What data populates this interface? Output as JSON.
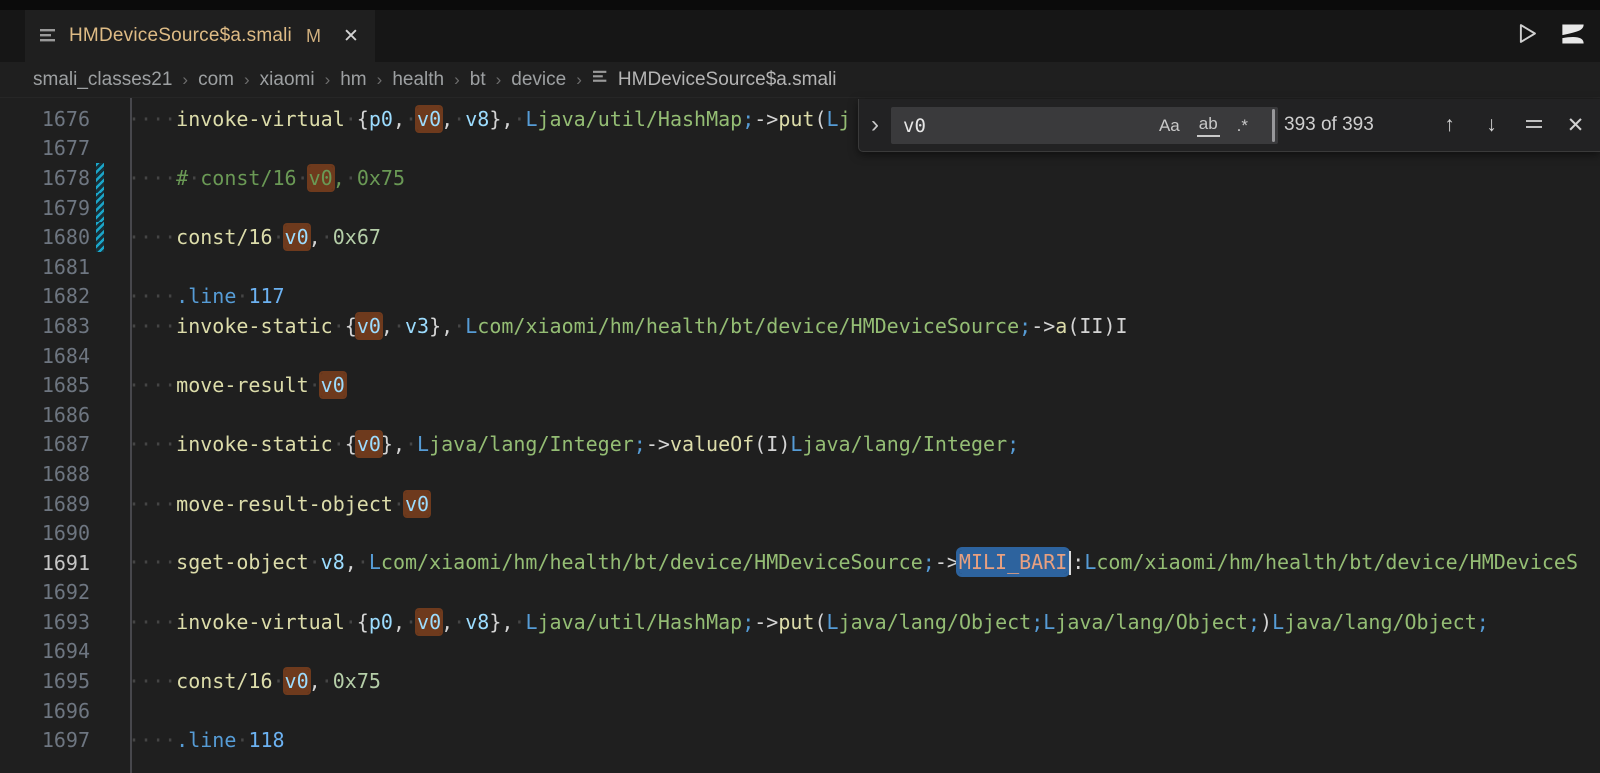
{
  "tab": {
    "title": "HMDeviceSource$a.smali",
    "modified_badge": "M",
    "close_glyph": "✕"
  },
  "breadcrumbs": {
    "items": [
      "smali_classes21",
      "com",
      "xiaomi",
      "hm",
      "health",
      "bt",
      "device"
    ],
    "separator": "›",
    "file_label": "HMDeviceSource$a.smali"
  },
  "find": {
    "expand_glyph": "›",
    "query": "v0",
    "match_case_label": "Aa",
    "whole_word_label": "ab",
    "regex_label": ".*",
    "results": "393 of 393",
    "prev_glyph": "↑",
    "next_glyph": "↓",
    "close_glyph": "✕"
  },
  "colors": {
    "op": "#dcdcaa",
    "reg": "#9cdcfe",
    "punc": "#d4d4d4",
    "type": "#569cd6",
    "path": "#94bd74",
    "num": "#b5cea8",
    "bnum": "#6cb2f2",
    "comment": "#6a9955",
    "field": "#e8a080",
    "ws": "#454545",
    "match": "#6e3a1d",
    "sel": "#2d639e",
    "tabModified": "#debb85",
    "gutterModified": "#1ba6ca",
    "lineNumber": "#6e7681",
    "lineNumberActive": "#c6c6c6"
  },
  "editor": {
    "lines": [
      {
        "n": "1676",
        "mod": false,
        "active": false,
        "seg": [
          [
            "ws",
            "····"
          ],
          [
            "op",
            "invoke-virtual"
          ],
          [
            "ws",
            "·"
          ],
          [
            "punc",
            "{"
          ],
          [
            "reg",
            "p0"
          ],
          [
            "punc",
            ","
          ],
          [
            "ws",
            "·"
          ],
          [
            "reg",
            "v0",
            "m"
          ],
          [
            "punc",
            ","
          ],
          [
            "ws",
            "·"
          ],
          [
            "reg",
            "v8"
          ],
          [
            "punc",
            "},"
          ],
          [
            "ws",
            "·"
          ],
          [
            "type",
            "L"
          ],
          [
            "path",
            "java/util/HashMap"
          ],
          [
            "type",
            ";"
          ],
          [
            "punc",
            "->"
          ],
          [
            "op",
            "put"
          ],
          [
            "punc",
            "("
          ],
          [
            "type",
            "L"
          ],
          [
            "path",
            "j"
          ]
        ]
      },
      {
        "n": "1677",
        "mod": false,
        "active": false,
        "seg": []
      },
      {
        "n": "1678",
        "mod": true,
        "active": false,
        "seg": [
          [
            "ws",
            "····"
          ],
          [
            "comment",
            "#"
          ],
          [
            "ws",
            "·"
          ],
          [
            "comment",
            "const/16"
          ],
          [
            "ws",
            "·"
          ],
          [
            "comment",
            "v0",
            "m"
          ],
          [
            "comment",
            ","
          ],
          [
            "ws",
            "·"
          ],
          [
            "comment",
            "0x75"
          ]
        ]
      },
      {
        "n": "1679",
        "mod": true,
        "active": false,
        "seg": []
      },
      {
        "n": "1680",
        "mod": true,
        "active": false,
        "seg": [
          [
            "ws",
            "····"
          ],
          [
            "op",
            "const/16"
          ],
          [
            "ws",
            "·"
          ],
          [
            "reg",
            "v0",
            "m"
          ],
          [
            "punc",
            ","
          ],
          [
            "ws",
            "·"
          ],
          [
            "num",
            "0x67"
          ]
        ]
      },
      {
        "n": "1681",
        "mod": false,
        "active": false,
        "seg": []
      },
      {
        "n": "1682",
        "mod": false,
        "active": false,
        "seg": [
          [
            "ws",
            "····"
          ],
          [
            "type",
            ".line"
          ],
          [
            "ws",
            "·"
          ],
          [
            "bnum",
            "117"
          ]
        ]
      },
      {
        "n": "1683",
        "mod": false,
        "active": false,
        "seg": [
          [
            "ws",
            "····"
          ],
          [
            "op",
            "invoke-static"
          ],
          [
            "ws",
            "·"
          ],
          [
            "punc",
            "{"
          ],
          [
            "reg",
            "v0",
            "m"
          ],
          [
            "punc",
            ","
          ],
          [
            "ws",
            "·"
          ],
          [
            "reg",
            "v3"
          ],
          [
            "punc",
            "},"
          ],
          [
            "ws",
            "·"
          ],
          [
            "type",
            "L"
          ],
          [
            "path",
            "com/xiaomi/hm/health/bt/device/HMDeviceSource"
          ],
          [
            "type",
            ";"
          ],
          [
            "punc",
            "->"
          ],
          [
            "op",
            "a"
          ],
          [
            "punc",
            "(II)I"
          ]
        ]
      },
      {
        "n": "1684",
        "mod": false,
        "active": false,
        "seg": []
      },
      {
        "n": "1685",
        "mod": false,
        "active": false,
        "seg": [
          [
            "ws",
            "····"
          ],
          [
            "op",
            "move-result"
          ],
          [
            "ws",
            "·"
          ],
          [
            "reg",
            "v0",
            "m"
          ]
        ]
      },
      {
        "n": "1686",
        "mod": false,
        "active": false,
        "seg": []
      },
      {
        "n": "1687",
        "mod": false,
        "active": false,
        "seg": [
          [
            "ws",
            "····"
          ],
          [
            "op",
            "invoke-static"
          ],
          [
            "ws",
            "·"
          ],
          [
            "punc",
            "{"
          ],
          [
            "reg",
            "v0",
            "m"
          ],
          [
            "punc",
            "},"
          ],
          [
            "ws",
            "·"
          ],
          [
            "type",
            "L"
          ],
          [
            "path",
            "java/lang/Integer"
          ],
          [
            "type",
            ";"
          ],
          [
            "punc",
            "->"
          ],
          [
            "op",
            "valueOf"
          ],
          [
            "punc",
            "(I)"
          ],
          [
            "type",
            "L"
          ],
          [
            "path",
            "java/lang/Integer"
          ],
          [
            "type",
            ";"
          ]
        ]
      },
      {
        "n": "1688",
        "mod": false,
        "active": false,
        "seg": []
      },
      {
        "n": "1689",
        "mod": false,
        "active": false,
        "seg": [
          [
            "ws",
            "····"
          ],
          [
            "op",
            "move-result-object"
          ],
          [
            "ws",
            "·"
          ],
          [
            "reg",
            "v0",
            "m"
          ]
        ]
      },
      {
        "n": "1690",
        "mod": false,
        "active": false,
        "seg": []
      },
      {
        "n": "1691",
        "mod": false,
        "active": true,
        "seg": [
          [
            "ws",
            "····"
          ],
          [
            "op",
            "sget-object"
          ],
          [
            "ws",
            "·"
          ],
          [
            "reg",
            "v8"
          ],
          [
            "punc",
            ","
          ],
          [
            "ws",
            "·"
          ],
          [
            "type",
            "L"
          ],
          [
            "path",
            "com/xiaomi/hm/health/bt/device/HMDeviceSource"
          ],
          [
            "type",
            ";"
          ],
          [
            "punc",
            "->"
          ],
          [
            "field",
            "MILI_BARI",
            "sel"
          ],
          [
            "cursor",
            ""
          ],
          [
            "punc",
            ":"
          ],
          [
            "type",
            "L"
          ],
          [
            "path",
            "com/xiaomi/hm/health/bt/device/HMDeviceS"
          ]
        ]
      },
      {
        "n": "1692",
        "mod": false,
        "active": false,
        "seg": []
      },
      {
        "n": "1693",
        "mod": false,
        "active": false,
        "seg": [
          [
            "ws",
            "····"
          ],
          [
            "op",
            "invoke-virtual"
          ],
          [
            "ws",
            "·"
          ],
          [
            "punc",
            "{"
          ],
          [
            "reg",
            "p0"
          ],
          [
            "punc",
            ","
          ],
          [
            "ws",
            "·"
          ],
          [
            "reg",
            "v0",
            "m"
          ],
          [
            "punc",
            ","
          ],
          [
            "ws",
            "·"
          ],
          [
            "reg",
            "v8"
          ],
          [
            "punc",
            "},"
          ],
          [
            "ws",
            "·"
          ],
          [
            "type",
            "L"
          ],
          [
            "path",
            "java/util/HashMap"
          ],
          [
            "type",
            ";"
          ],
          [
            "punc",
            "->"
          ],
          [
            "op",
            "put"
          ],
          [
            "punc",
            "("
          ],
          [
            "type",
            "L"
          ],
          [
            "path",
            "java/lang/Object"
          ],
          [
            "type",
            ";"
          ],
          [
            "type",
            "L"
          ],
          [
            "path",
            "java/lang/Object"
          ],
          [
            "type",
            ";"
          ],
          [
            "punc",
            ")"
          ],
          [
            "type",
            "L"
          ],
          [
            "path",
            "java/lang/Object"
          ],
          [
            "type",
            ";"
          ]
        ]
      },
      {
        "n": "1694",
        "mod": false,
        "active": false,
        "seg": []
      },
      {
        "n": "1695",
        "mod": false,
        "active": false,
        "seg": [
          [
            "ws",
            "····"
          ],
          [
            "op",
            "const/16"
          ],
          [
            "ws",
            "·"
          ],
          [
            "reg",
            "v0",
            "m"
          ],
          [
            "punc",
            ","
          ],
          [
            "ws",
            "·"
          ],
          [
            "num",
            "0x75"
          ]
        ]
      },
      {
        "n": "1696",
        "mod": false,
        "active": false,
        "seg": []
      },
      {
        "n": "1697",
        "mod": false,
        "active": false,
        "seg": [
          [
            "ws",
            "····"
          ],
          [
            "type",
            ".line"
          ],
          [
            "ws",
            "·"
          ],
          [
            "bnum",
            "118"
          ]
        ]
      }
    ]
  }
}
